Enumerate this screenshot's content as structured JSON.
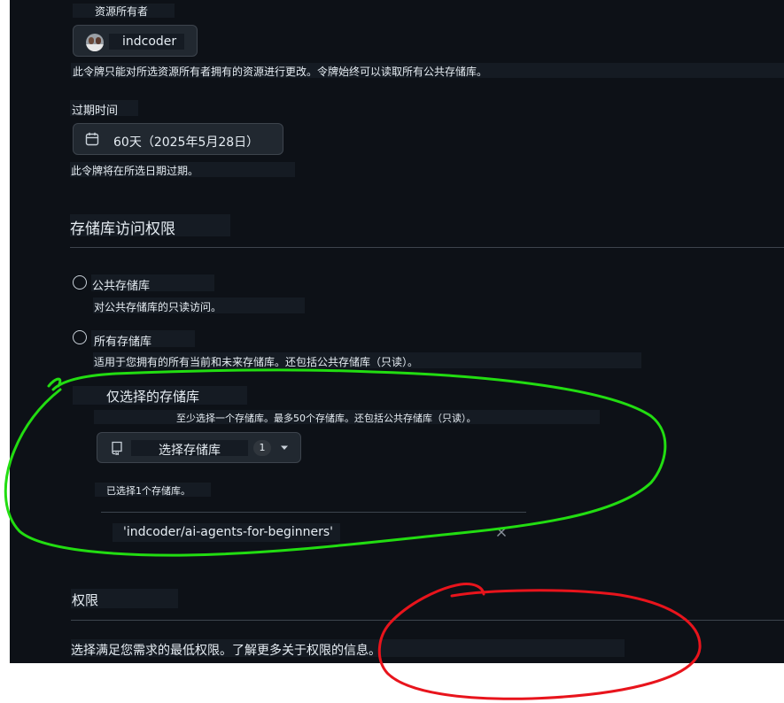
{
  "owner": {
    "label": "资源所有者",
    "name": "indcoder",
    "note": "此令牌只能对所选资源所有者拥有的资源进行更改。令牌始终可以读取所有公共存储库。"
  },
  "expiration": {
    "label": "过期时间",
    "value": "60天（2025年5月28日）",
    "note": "此令牌将在所选日期过期。"
  },
  "repo_access": {
    "heading": "存储库访问权限",
    "options": [
      {
        "label": "公共存储库",
        "desc": "对公共存储库的只读访问。"
      },
      {
        "label": "所有存储库",
        "desc": "适用于您拥有的所有当前和未来存储库。还包括公共存储库（只读）。"
      },
      {
        "label": "仅选择的存储库",
        "desc": "至少选择一个存储库。最多50个存储库。还包括公共存储库（只读）。"
      }
    ],
    "select_button": {
      "label": "选择存储库",
      "count": "1"
    },
    "selected_note": "已选择1个存储库。",
    "selected_repo": "'indcoder/ai-agents-for-beginners'"
  },
  "permissions": {
    "heading": "权限",
    "note": "选择满足您需求的最低权限。了解更多关于权限的信息。"
  },
  "annotations": {
    "green_circle_color": "#22dd11",
    "red_circle_color": "#e8141c"
  }
}
